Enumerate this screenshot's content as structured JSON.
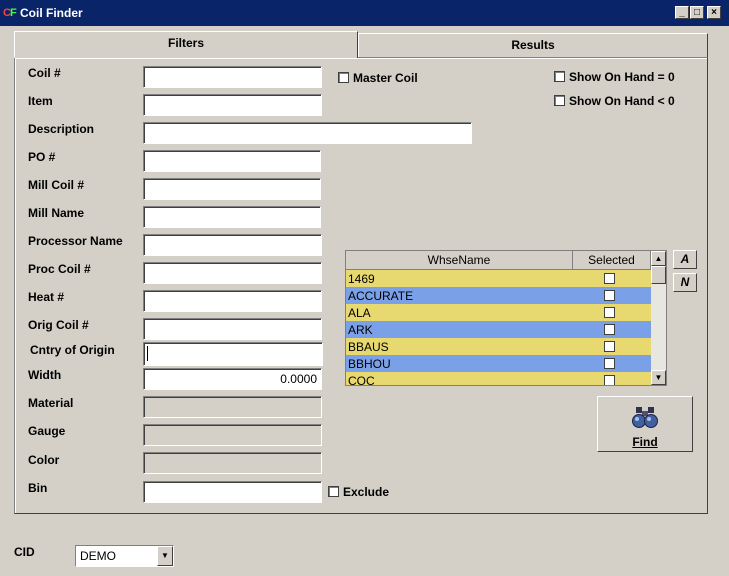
{
  "window": {
    "title": "Coil Finder",
    "buttons": [
      "_",
      "□",
      "×"
    ]
  },
  "tabs": [
    {
      "label": "Filters",
      "active": true
    },
    {
      "label": "Results",
      "active": false
    }
  ],
  "fields": {
    "coil": {
      "label": "Coil #",
      "value": ""
    },
    "item": {
      "label": "Item",
      "value": ""
    },
    "description": {
      "label": "Description",
      "value": ""
    },
    "po": {
      "label": "PO #",
      "value": ""
    },
    "mill_coil": {
      "label": "Mill Coil #",
      "value": ""
    },
    "mill_name": {
      "label": "Mill Name",
      "value": ""
    },
    "processor_name": {
      "label": "Processor Name",
      "value": ""
    },
    "proc_coil": {
      "label": "Proc Coil #",
      "value": ""
    },
    "heat": {
      "label": "Heat #",
      "value": ""
    },
    "orig_coil": {
      "label": "Orig Coil #",
      "value": ""
    },
    "cntry_origin": {
      "label": "Cntry of Origin",
      "value": ""
    },
    "width": {
      "label": "Width",
      "value": "0.0000"
    },
    "material": {
      "label": "Material",
      "value": ""
    },
    "gauge": {
      "label": "Gauge",
      "value": ""
    },
    "color": {
      "label": "Color",
      "value": ""
    },
    "bin": {
      "label": "Bin",
      "value": ""
    }
  },
  "checkboxes": {
    "master_coil": "Master Coil",
    "show_on_hand_zero": "Show On Hand = 0",
    "show_on_hand_neg": "Show On Hand < 0",
    "exclude": "Exclude"
  },
  "warehouse_grid": {
    "headers": [
      "WhseName",
      "Selected"
    ],
    "rows": [
      "1469",
      "ACCURATE",
      "ALA",
      "ARK",
      "BBAUS",
      "BBHOU",
      "COC"
    ],
    "row_colors": [
      "#e8d870",
      "#7aa0e8"
    ]
  },
  "side_buttons": {
    "a": "A",
    "n": "N"
  },
  "find_button": {
    "label": "Find",
    "icon": "binoculars-icon"
  },
  "cid": {
    "label": "CID",
    "value": "DEMO"
  }
}
